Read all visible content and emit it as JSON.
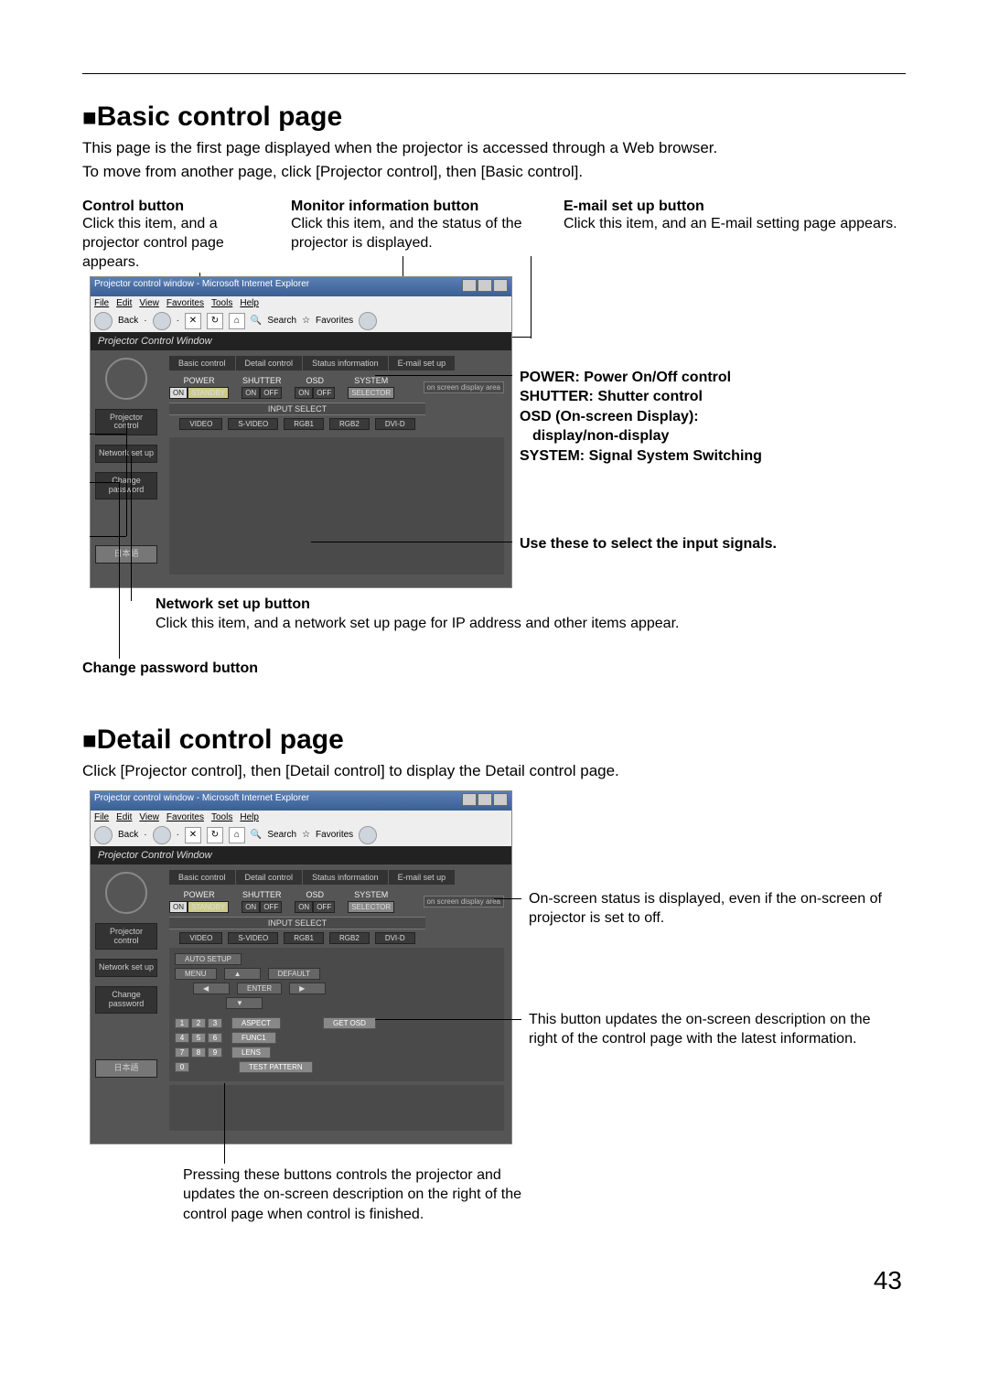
{
  "page_number": "43",
  "section1": {
    "heading": "Basic control page",
    "intro1": "This page is the first page displayed when the projector is accessed through a Web browser.",
    "intro2": "To move from another page, click [Projector control], then [Basic control].",
    "cols": {
      "control": {
        "label": "Control button",
        "text": "Click this item, and a projector control page appears."
      },
      "monitor": {
        "label": "Monitor information button",
        "text": "Click this item, and the status of the projector is displayed."
      },
      "email": {
        "label": "E-mail set up button",
        "text": "Click this item, and an E-mail setting page appears."
      }
    },
    "right_labels": {
      "power": "POWER: Power On/Off control",
      "shutter": "SHUTTER: Shutter control",
      "osd1": "OSD (On-screen Display):",
      "osd2": "display/non-display",
      "system": "SYSTEM: Signal System Switching",
      "input": "Use these to select the input signals."
    },
    "bottom": {
      "network_label": "Network set up button",
      "network_text": "Click this item, and a network set up page for IP address and other items appear.",
      "changepw": "Change password button"
    }
  },
  "section2": {
    "heading": "Detail control page",
    "intro": "Click [Projector control], then [Detail control] to display the Detail control page.",
    "right1": "On-screen status is displayed, even if the on-screen of projector is set to off.",
    "right2": "This button updates the on-screen description on the right of the control page with the latest information.",
    "bottom": "Pressing these buttons controls the projector and updates the on-screen description on the right of the control page when control is finished."
  },
  "ie": {
    "title": "Projector control window - Microsoft Internet Explorer",
    "menus": {
      "file": "File",
      "edit": "Edit",
      "view": "View",
      "fav": "Favorites",
      "tools": "Tools",
      "help": "Help"
    },
    "toolbar": {
      "back": "Back",
      "search": "Search",
      "favorites": "Favorites"
    },
    "header": "Projector Control Window",
    "side": {
      "projector": "Projector control",
      "network": "Network set up",
      "change": "Change password",
      "jp": "日本語"
    },
    "tabs": {
      "basic": "Basic control",
      "detail": "Detail control",
      "status": "Status information",
      "email": "E-mail set up"
    },
    "controls": {
      "power": "POWER",
      "shutter": "SHUTTER",
      "osd": "OSD",
      "system": "SYSTEM",
      "on": "ON",
      "standby": "STANDBY",
      "off": "OFF",
      "selector": "SELECTOR",
      "inputselect": "INPUT SELECT",
      "video": "VIDEO",
      "svideo": "S-VIDEO",
      "rgb1": "RGB1",
      "rgb2": "RGB2",
      "dvid": "DVI-D",
      "onscreen": "on screen display area"
    },
    "detail": {
      "autosetup": "AUTO SETUP",
      "menu": "MENU",
      "default": "DEFAULT",
      "enter": "ENTER",
      "aspect": "ASPECT",
      "func1": "FUNC1",
      "lens": "LENS",
      "testpattern": "TEST PATTERN",
      "getosd": "GET OSD",
      "n0": "0",
      "n1": "1",
      "n2": "2",
      "n3": "3",
      "n4": "4",
      "n5": "5",
      "n6": "6",
      "n7": "7",
      "n8": "8",
      "n9": "9",
      "up": "▲",
      "down": "▼",
      "left": "◀",
      "right": "▶"
    }
  }
}
